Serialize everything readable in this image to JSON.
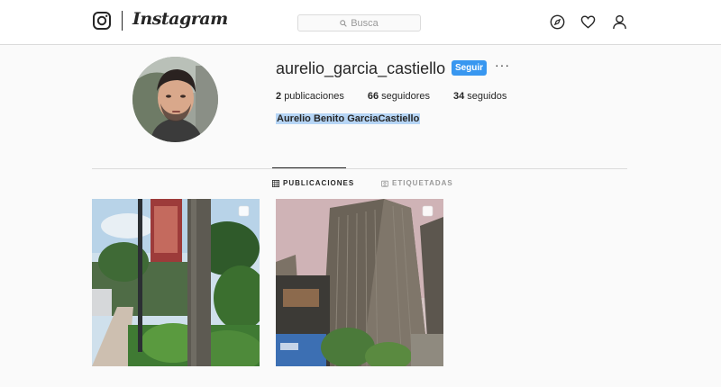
{
  "header": {
    "brand": "Instagram",
    "search_placeholder": "Busca",
    "icons": [
      "instagram-logo-icon",
      "search-icon",
      "compass-icon",
      "heart-icon",
      "user-icon"
    ]
  },
  "profile": {
    "username": "aurelio_garcia_castiello",
    "follow_label": "Seguir",
    "more_label": "···",
    "stats": [
      {
        "count": "2",
        "label": "publicaciones"
      },
      {
        "count": "66",
        "label": "seguidores"
      },
      {
        "count": "34",
        "label": "seguidos"
      }
    ],
    "full_name": "Aurelio Benito GarciaCastiello"
  },
  "tabs": [
    {
      "label": "PUBLICACIONES",
      "active": true,
      "icon": "grid-icon"
    },
    {
      "label": "ETIQUETADAS",
      "active": false,
      "icon": "tag-icon"
    }
  ],
  "colors": {
    "accent": "#3897f0",
    "selection": "#b6d5f5",
    "border": "#dbdbdb",
    "background": "#fafafa"
  }
}
